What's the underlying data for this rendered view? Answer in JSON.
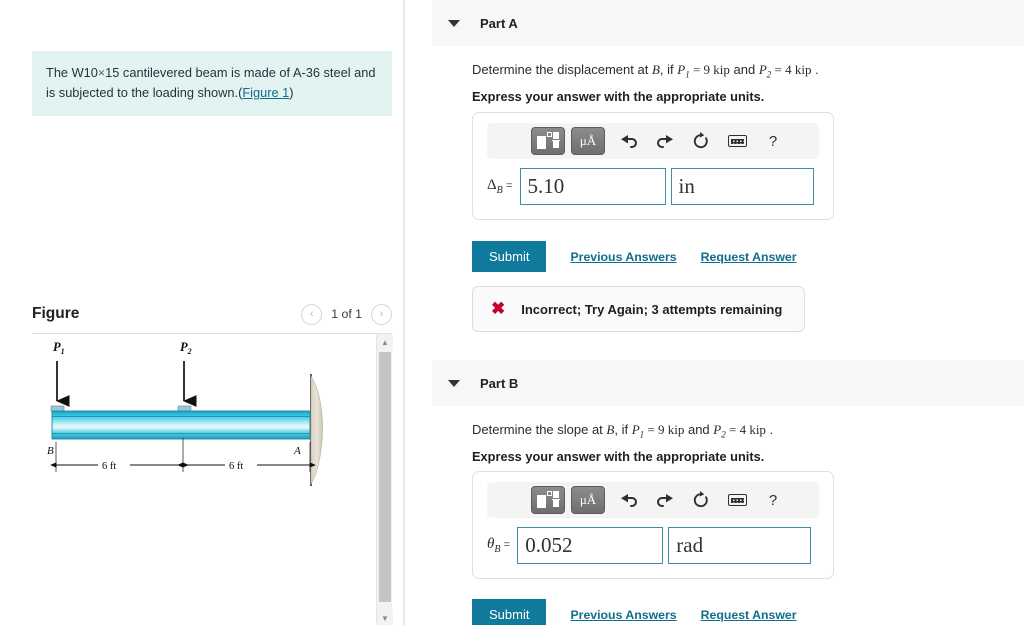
{
  "left": {
    "problem_text_1": "The W10",
    "problem_times": "×",
    "problem_text_2": "15 cantilevered beam is made of A-36 steel and is subjected to the loading shown.(",
    "figure_link": "Figure 1",
    "problem_text_3": ")",
    "figure_title": "Figure",
    "figure_counter": "1 of 1",
    "prev_arrow": "‹",
    "next_arrow": "›",
    "scroll_up": "▲",
    "scroll_down": "▼"
  },
  "figure": {
    "load1_label": "P",
    "load1_sub": "1",
    "load2_label": "P",
    "load2_sub": "2",
    "node_left": "B",
    "node_right": "A",
    "dim_left": "6 ft",
    "dim_right": "6 ft",
    "beam_color_top": "#2fc4dd",
    "beam_color_mid": "#eaf7fb",
    "beam_color_edge": "#1794b0"
  },
  "toolbar": {
    "template_title": "math template",
    "units_label": "μÅ",
    "undo": "↶",
    "redo": "↷",
    "reset": "↺",
    "keyboard": "keyboard",
    "help": "?"
  },
  "partA": {
    "header": "Part A",
    "question_pre": "Determine the displacement at ",
    "question_var_b": "B",
    "question_mid": ", if ",
    "p1": "P",
    "p1_sub": "1",
    "p1_val": " = 9 kip",
    "and": " and ",
    "p2": "P",
    "p2_sub": "2",
    "p2_val": " = 4 kip",
    "question_end": " .",
    "instruction": "Express your answer with the appropriate units.",
    "answer_symbol": "Δ",
    "answer_symbol_sub": "B",
    "answer_eq": " = ",
    "answer_value": "5.10",
    "answer_unit": "in",
    "submit_label": "Submit",
    "previous_answers": "Previous Answers",
    "request_answer": "Request Answer",
    "feedback_icon": "✖",
    "feedback_text": "Incorrect; Try Again; 3 attempts remaining"
  },
  "partB": {
    "header": "Part B",
    "question_pre": "Determine the slope at ",
    "question_var_b": "B",
    "question_mid": ", if ",
    "p1": "P",
    "p1_sub": "1",
    "p1_val": " = 9 kip",
    "and": " and ",
    "p2": "P",
    "p2_sub": "2",
    "p2_val": " = 4 kip",
    "question_end": " .",
    "instruction": "Express your answer with the appropriate units.",
    "answer_symbol": "θ",
    "answer_symbol_sub": "B",
    "answer_eq": " = ",
    "answer_value": "0.052",
    "answer_unit": "rad",
    "submit_label": "Submit",
    "previous_answers": "Previous Answers",
    "request_answer": "Request Answer"
  },
  "colors": {
    "accent": "#107a9c",
    "link": "#0f6e8c",
    "problem_bg": "#e3f3f1",
    "header_bg": "#f7f7f7",
    "error": "#c3002f",
    "input_border": "#3f8ea3"
  }
}
